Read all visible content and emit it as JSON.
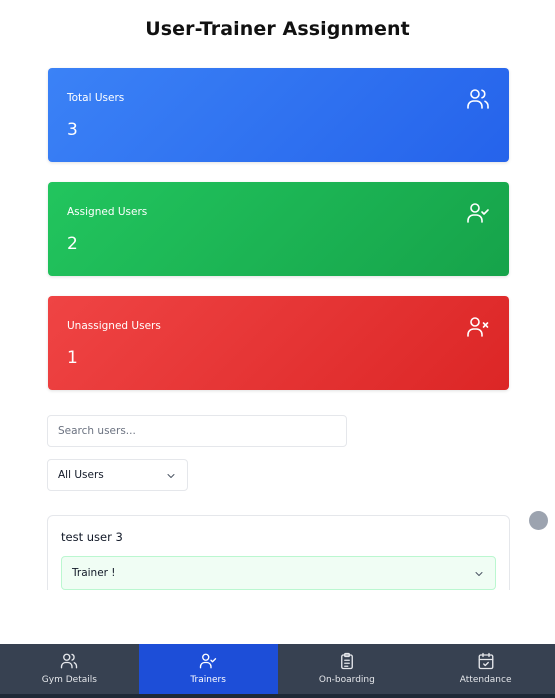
{
  "header": {
    "title": "User-Trainer Assignment"
  },
  "stats": [
    {
      "label": "Total Users",
      "value": "3",
      "icon": "users-icon",
      "color": "#2563eb"
    },
    {
      "label": "Assigned Users",
      "value": "2",
      "icon": "user-check-icon",
      "color": "#16a34a"
    },
    {
      "label": "Unassigned Users",
      "value": "1",
      "icon": "user-x-icon",
      "color": "#dc2626"
    }
  ],
  "search": {
    "placeholder": "Search users...",
    "value": ""
  },
  "filter": {
    "selected": "All Users"
  },
  "users": [
    {
      "name": "test user 3",
      "trainer": "Trainer !"
    }
  ],
  "nav": {
    "items": [
      {
        "label": "Gym Details",
        "icon": "users-icon"
      },
      {
        "label": "Trainers",
        "icon": "user-check-icon",
        "active": true
      },
      {
        "label": "On-boarding",
        "icon": "clipboard-icon"
      },
      {
        "label": "Attendance",
        "icon": "calendar-check-icon"
      }
    ],
    "active_color": "#1d4ed8",
    "bg_color": "#374151"
  }
}
